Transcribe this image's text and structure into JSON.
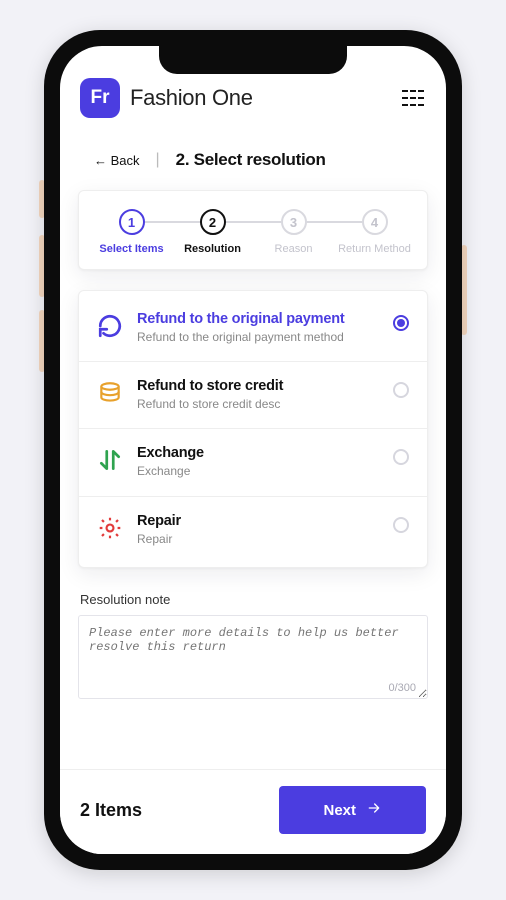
{
  "header": {
    "logo_text": "Fr",
    "app_name": "Fashion One"
  },
  "nav": {
    "back_label": "← Back",
    "title": "2. Select resolution"
  },
  "stepper": {
    "steps": [
      {
        "num": "1",
        "label": "Select Items",
        "state": "done"
      },
      {
        "num": "2",
        "label": "Resolution",
        "state": "curr"
      },
      {
        "num": "3",
        "label": "Reason",
        "state": "todo"
      },
      {
        "num": "4",
        "label": "Return Method",
        "state": "todo"
      }
    ]
  },
  "options": [
    {
      "icon": "refresh-icon",
      "title": "Refund to the original payment",
      "desc": "Refund to the original payment method",
      "selected": true
    },
    {
      "icon": "coins-icon",
      "title": "Refund to store credit",
      "desc": "Refund to store credit desc",
      "selected": false
    },
    {
      "icon": "exchange-icon",
      "title": "Exchange",
      "desc": "Exchange",
      "selected": false
    },
    {
      "icon": "gear-icon",
      "title": "Repair",
      "desc": "Repair",
      "selected": false
    }
  ],
  "note": {
    "label": "Resolution note",
    "placeholder": "Please enter more details to help us better resolve this return",
    "char_count": "0/300"
  },
  "footer": {
    "item_count_label": "2 Items",
    "next_label": "Next"
  },
  "colors": {
    "accent": "#4b3de0"
  }
}
